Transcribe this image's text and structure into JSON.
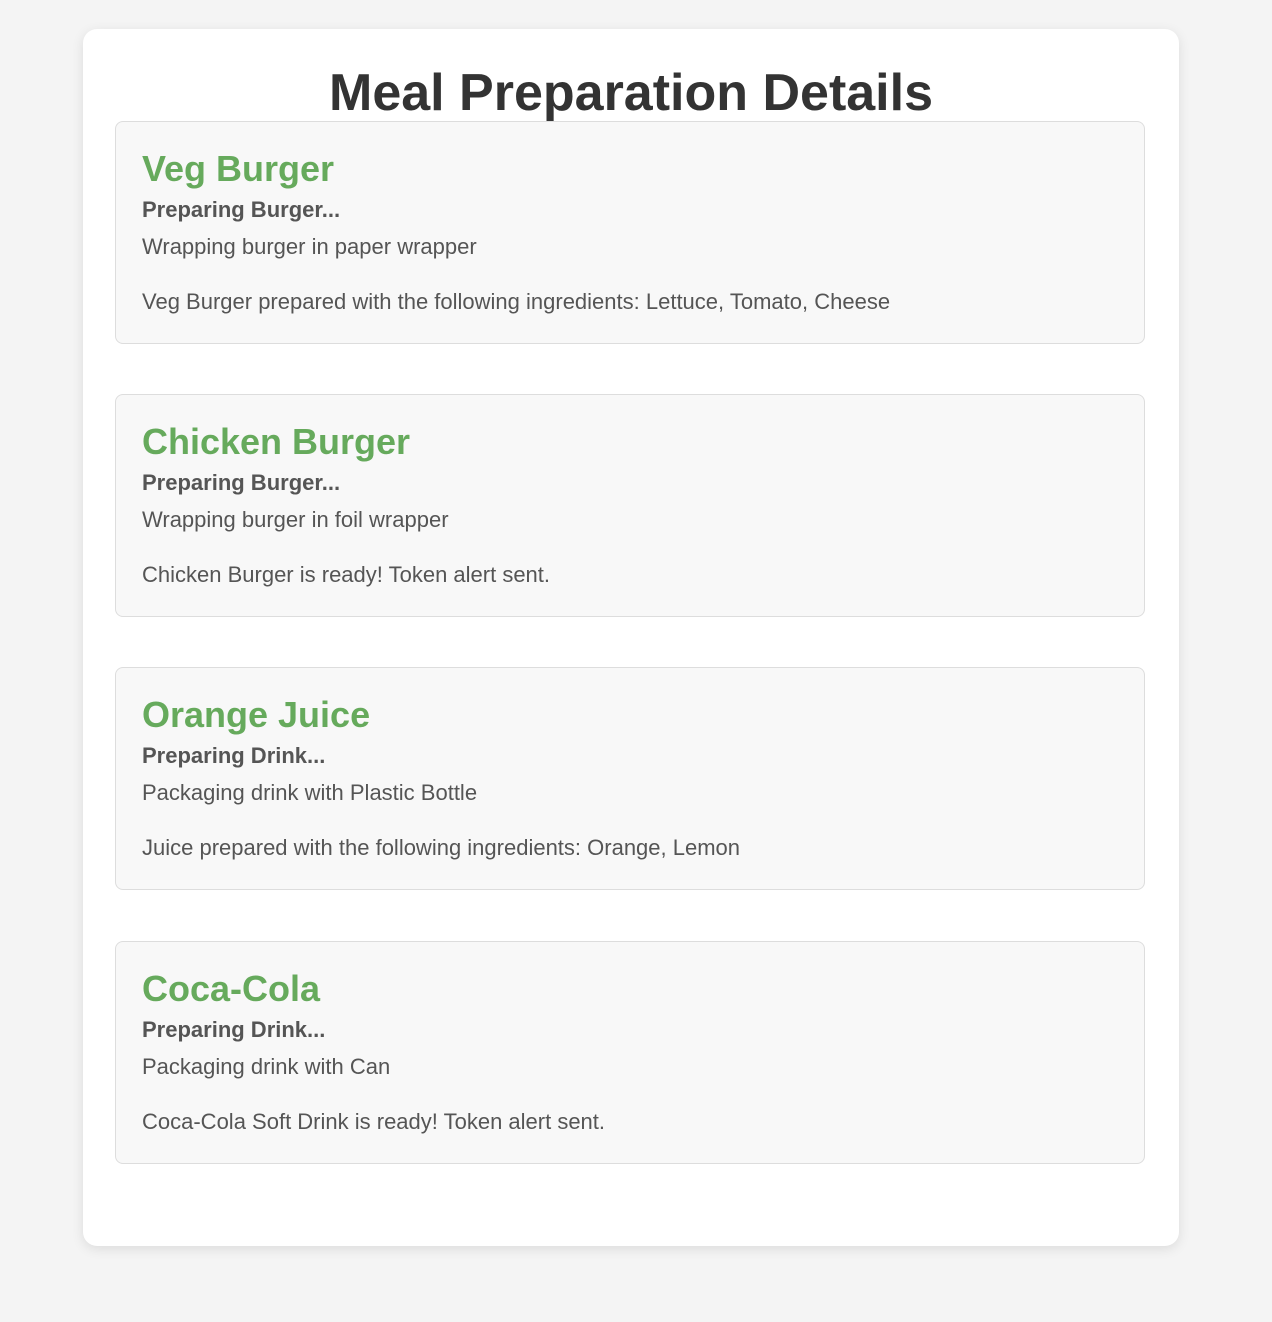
{
  "page": {
    "title": "Meal Preparation Details"
  },
  "colors": {
    "background": "#f4f4f4",
    "panel": "#ffffff",
    "card": "#f8f8f8",
    "item_title": "#66aa5c",
    "heading": "#333333",
    "text": "#555555"
  },
  "items": [
    {
      "name": "Veg Burger",
      "status": "Preparing Burger...",
      "step": "Wrapping burger in paper wrapper",
      "result": "Veg Burger prepared with the following ingredients: Lettuce, Tomato, Cheese"
    },
    {
      "name": "Chicken Burger",
      "status": "Preparing Burger...",
      "step": "Wrapping burger in foil wrapper",
      "result": "Chicken Burger is ready! Token alert sent."
    },
    {
      "name": "Orange Juice",
      "status": "Preparing Drink...",
      "step": "Packaging drink with Plastic Bottle",
      "result": "Juice prepared with the following ingredients: Orange, Lemon"
    },
    {
      "name": "Coca-Cola",
      "status": "Preparing Drink...",
      "step": "Packaging drink with Can",
      "result": "Coca-Cola Soft Drink is ready! Token alert sent."
    }
  ]
}
